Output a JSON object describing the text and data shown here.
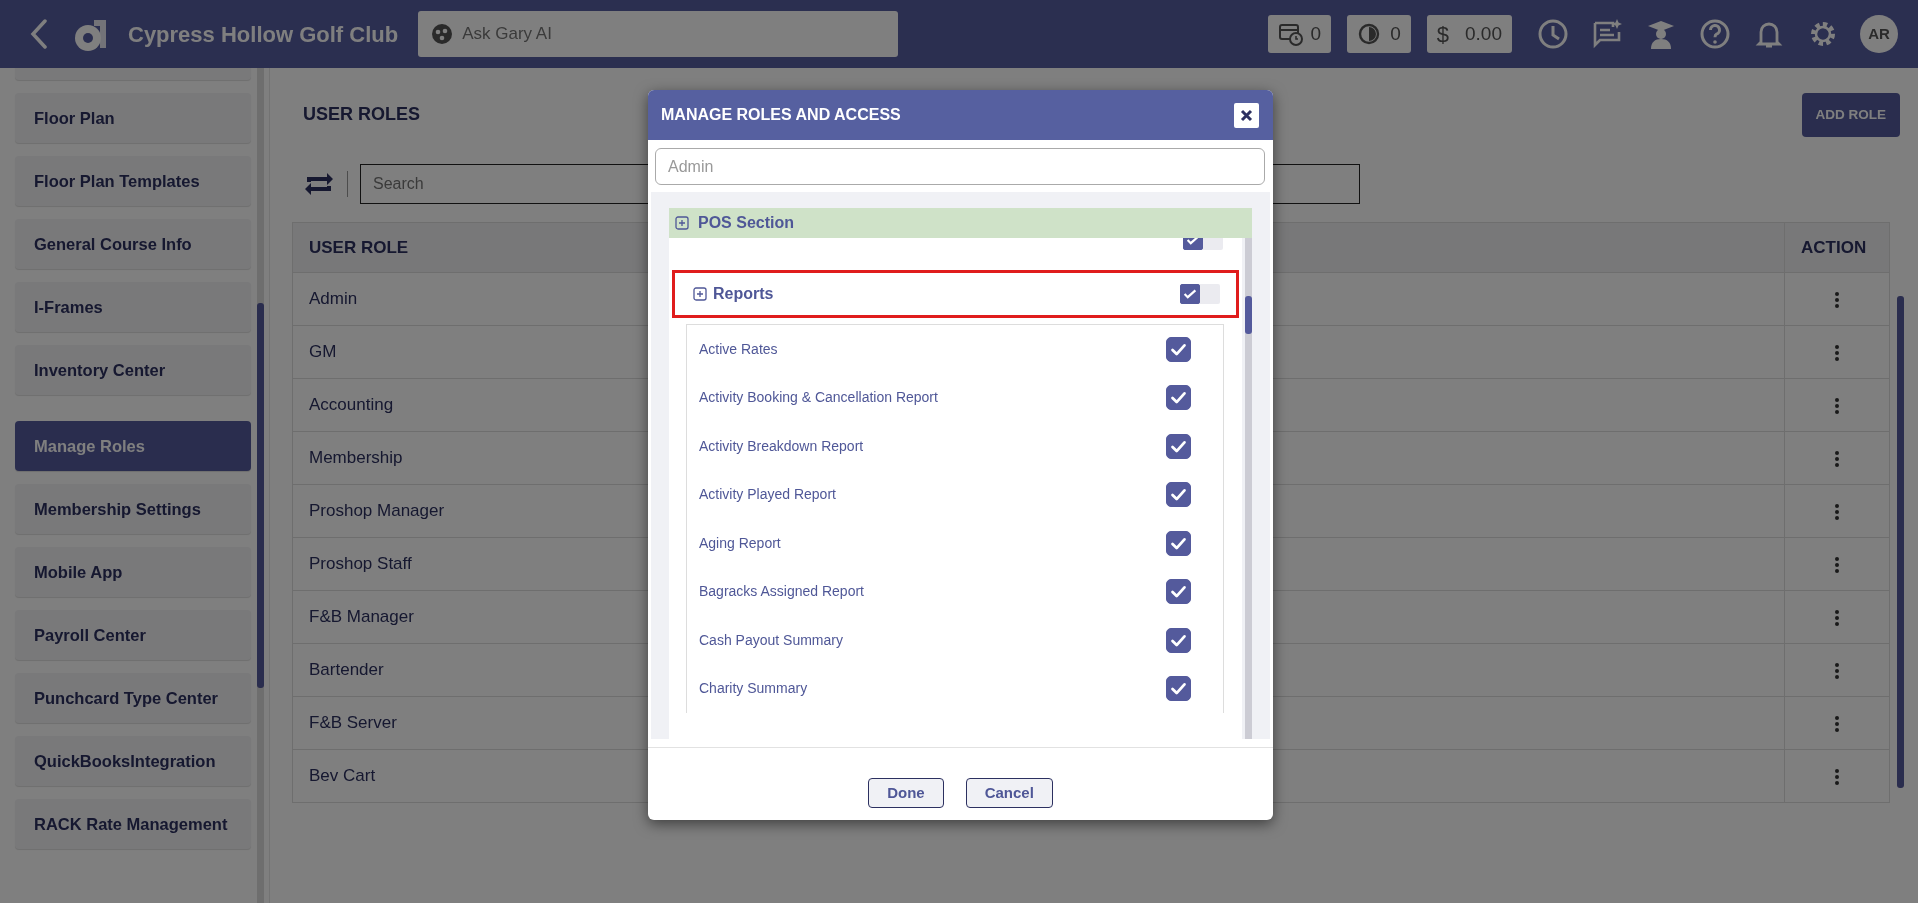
{
  "topbar": {
    "title": "Cypress Hollow Golf Club",
    "search": {
      "placeholder": "Ask Gary AI"
    },
    "counters": [
      {
        "kind": "bookings",
        "value": "0"
      },
      {
        "kind": "timer",
        "value": "0"
      },
      {
        "kind": "money",
        "symbol": "$",
        "value": "0.00"
      }
    ],
    "avatar": "AR"
  },
  "sidebar": {
    "items": [
      {
        "label": "Floor Plan",
        "selected": false
      },
      {
        "label": "Floor Plan Templates",
        "selected": false
      },
      {
        "label": "General Course Info",
        "selected": false
      },
      {
        "label": "I-Frames",
        "selected": false
      },
      {
        "label": "Inventory Center",
        "selected": false
      },
      {
        "label": "Manage Roles",
        "selected": true
      },
      {
        "label": "Membership Settings",
        "selected": false
      },
      {
        "label": "Mobile App",
        "selected": false
      },
      {
        "label": "Payroll Center",
        "selected": false
      },
      {
        "label": "Punchcard Type Center",
        "selected": false
      },
      {
        "label": "QuickBooksIntegration",
        "selected": false
      },
      {
        "label": "RACK Rate Management",
        "selected": false
      }
    ]
  },
  "page": {
    "title": "USER ROLES",
    "add_button": "ADD ROLE",
    "search": {
      "placeholder": "Search"
    },
    "table": {
      "columns": [
        "USER ROLE",
        "ACTION"
      ],
      "rows": [
        "Admin",
        "GM",
        "Accounting",
        "Membership",
        "Proshop Manager",
        "Proshop Staff",
        "F&B Manager",
        "Bartender",
        "F&B Server",
        "Bev Cart"
      ]
    }
  },
  "modal": {
    "title": "MANAGE ROLES AND ACCESS",
    "role_field": {
      "value": "Admin",
      "disabled": true
    },
    "section": {
      "label": "POS Section"
    },
    "groups": [
      {
        "checked": true
      },
      {
        "label": "Reports",
        "checked": true,
        "highlighted": true,
        "items": [
          {
            "label": "Active Rates",
            "checked": true
          },
          {
            "label": "Activity Booking & Cancellation Report",
            "checked": true
          },
          {
            "label": "Activity Breakdown Report",
            "checked": true
          },
          {
            "label": "Activity Played Report",
            "checked": true
          },
          {
            "label": "Aging Report",
            "checked": true
          },
          {
            "label": "Bagracks Assigned Report",
            "checked": true
          },
          {
            "label": "Cash Payout Summary",
            "checked": true
          },
          {
            "label": "Charity Summary",
            "checked": true
          }
        ]
      }
    ],
    "buttons": [
      "Done",
      "Cancel"
    ]
  }
}
